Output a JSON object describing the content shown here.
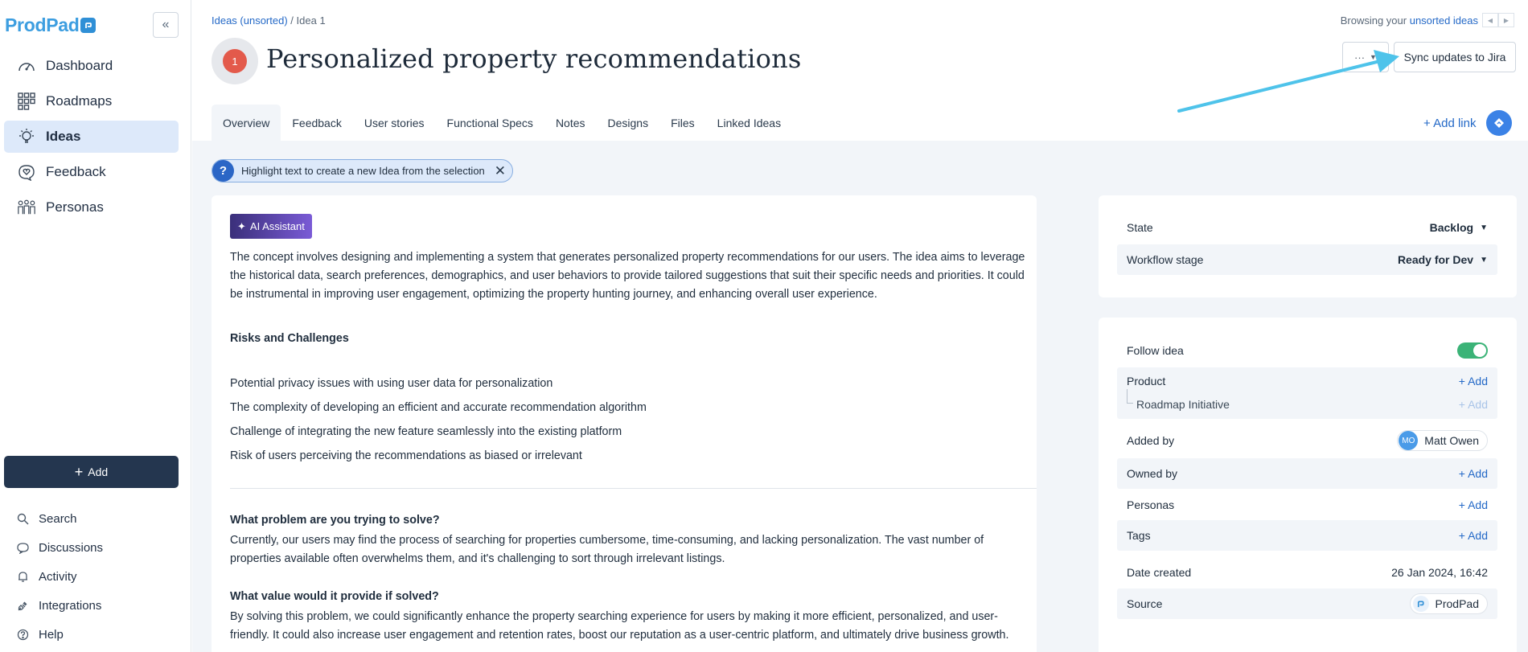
{
  "app": {
    "logo_text": "ProdPad"
  },
  "sidebar": {
    "items": [
      {
        "label": "Dashboard",
        "icon": "gauge-icon"
      },
      {
        "label": "Roadmaps",
        "icon": "grid-icon"
      },
      {
        "label": "Ideas",
        "icon": "lightbulb-icon",
        "active": true
      },
      {
        "label": "Feedback",
        "icon": "heart-speech-icon"
      },
      {
        "label": "Personas",
        "icon": "people-icon"
      }
    ],
    "add_label": "Add",
    "bottom": [
      {
        "label": "Search",
        "icon": "search-icon"
      },
      {
        "label": "Discussions",
        "icon": "chat-icon"
      },
      {
        "label": "Activity",
        "icon": "bell-icon"
      },
      {
        "label": "Integrations",
        "icon": "plug-icon"
      },
      {
        "label": "Help",
        "icon": "help-icon"
      }
    ]
  },
  "header": {
    "breadcrumb_parent": "Ideas (unsorted)",
    "breadcrumb_sep": "/",
    "breadcrumb_current": "Idea 1",
    "browsing_prefix": "Browsing your",
    "browsing_link": "unsorted ideas",
    "idea_number": "1",
    "title": "Personalized property recommendations",
    "more_label": "···",
    "sync_label": "Sync updates to Jira"
  },
  "tabs": [
    "Overview",
    "Feedback",
    "User stories",
    "Functional Specs",
    "Notes",
    "Designs",
    "Files",
    "Linked Ideas"
  ],
  "add_link_label": "+ Add link",
  "hint": {
    "text": "Highlight text to create a new Idea from the selection"
  },
  "doc": {
    "ai_label": "AI Assistant",
    "intro": "The concept involves designing and implementing a system that generates personalized property recommendations for our users. The idea aims to leverage the historical data, search preferences, demographics, and user behaviors to provide tailored suggestions that suit their specific needs and priorities. It could be instrumental in improving user engagement, optimizing the property hunting journey, and enhancing overall user experience.",
    "risks_heading": "Risks and Challenges",
    "risks": [
      "Potential privacy issues with using user data for personalization",
      "The complexity of developing an efficient and accurate recommendation algorithm",
      "Challenge of integrating the new feature seamlessly into the existing platform",
      "Risk of users perceiving the recommendations as biased or irrelevant"
    ],
    "q1": "What problem are you trying to solve?",
    "a1": "Currently, our users may find the process of searching for properties cumbersome, time-consuming, and lacking personalization. The vast number of properties available often overwhelms them, and it's challenging to sort through irrelevant listings.",
    "q2": "What value would it provide if solved?",
    "a2": "By solving this problem, we could significantly enhance the property searching experience for users by making it more efficient, personalized, and user-friendly. It could also increase user engagement and retention rates, boost our reputation as a user-centric platform, and ultimately drive business growth."
  },
  "status_panel": {
    "state_label": "State",
    "state_value": "Backlog",
    "workflow_label": "Workflow stage",
    "workflow_value": "Ready for Dev"
  },
  "details_panel": {
    "follow_label": "Follow idea",
    "follow_on": true,
    "product_label": "Product",
    "product_add": "+ Add",
    "initiative_label": "Roadmap Initiative",
    "initiative_add": "+ Add",
    "added_by_label": "Added by",
    "added_by_initials": "MO",
    "added_by_name": "Matt Owen",
    "owned_by_label": "Owned by",
    "owned_by_add": "+ Add",
    "personas_label": "Personas",
    "personas_add": "+ Add",
    "tags_label": "Tags",
    "tags_add": "+ Add",
    "date_label": "Date created",
    "date_value": "26 Jan 2024, 16:42",
    "source_label": "Source",
    "source_value": "ProdPad"
  },
  "colors": {
    "brand": "#3d9ee0",
    "accent": "#2469c7",
    "nav_active": "#dde9fa",
    "add_button": "#24364f",
    "badge": "#e35a4b",
    "toggle_on": "#3bb377",
    "annotation_arrow": "#4ec3ea"
  }
}
